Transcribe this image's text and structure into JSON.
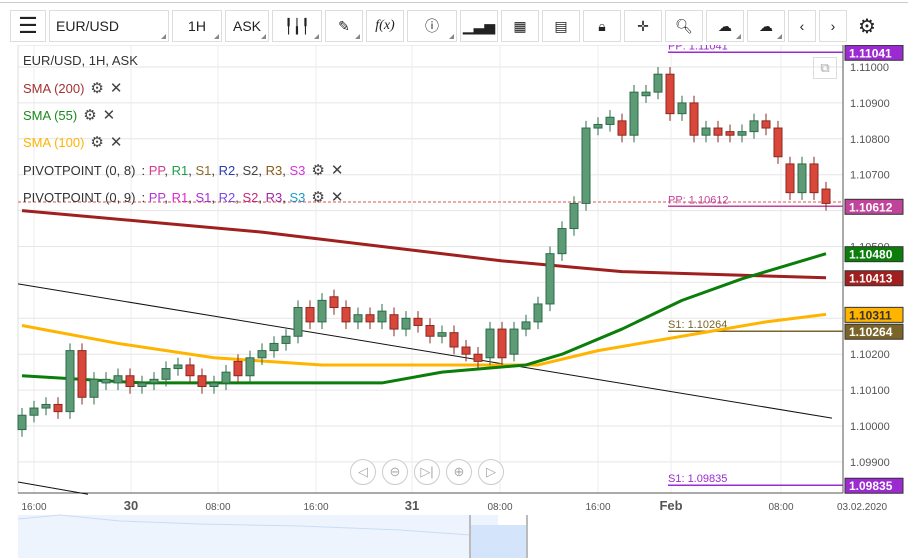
{
  "toolbar": {
    "menu_icon": "menu-icon",
    "symbol": "EUR/USD",
    "interval": "1H",
    "price_type": "ASK",
    "buttons": [
      "candles-icon",
      "draw-icon",
      "function-icon",
      "info-icon",
      "bars-icon",
      "calendar-icon",
      "report-icon",
      "lock-icon",
      "crosshair-icon",
      "zoom-icon",
      "upload-icon",
      "download-icon",
      "prev-icon",
      "next-icon",
      "gear-icon"
    ],
    "fx_label": "f(x)"
  },
  "legend": {
    "title": "EUR/USD, 1H, ASK",
    "sma200": "SMA (200)",
    "sma55": "SMA (55)",
    "sma100": "SMA (100)",
    "pivot1": "PIVOTPOINT (0, 8)",
    "pivot2": "PIVOTPOINT (0, 9)",
    "sep": " : ",
    "pivot1_items": [
      {
        "t": "PP",
        "c": "#d63a8e"
      },
      {
        "t": "R1",
        "c": "#1aa04a"
      },
      {
        "t": "S1",
        "c": "#8a6a2a"
      },
      {
        "t": "R2",
        "c": "#2a3eb0"
      },
      {
        "t": "S2",
        "c": "#444444"
      },
      {
        "t": "R3",
        "c": "#8a5a1a"
      },
      {
        "t": "S3",
        "c": "#d632d6"
      }
    ],
    "pivot2_items": [
      {
        "t": "PP",
        "c": "#b238d6"
      },
      {
        "t": "R1",
        "c": "#e02ad0"
      },
      {
        "t": "S1",
        "c": "#a030d0"
      },
      {
        "t": "R2",
        "c": "#7a4ae0"
      },
      {
        "t": "S2",
        "c": "#c02a7a"
      },
      {
        "t": "R3",
        "c": "#a028a8"
      },
      {
        "t": "S3",
        "c": "#1a9ac8"
      }
    ]
  },
  "colors": {
    "up": "#5d9a76",
    "down": "#d9473a",
    "sma200": "#a01f1f",
    "sma55": "#0a7d0a",
    "sma100": "#ffb400"
  },
  "chart_data": {
    "type": "candlestick",
    "ylim": [
      1.0978,
      1.111
    ],
    "y_ticks": [
      "1.11000",
      "1.10900",
      "1.10800",
      "1.10700",
      "1.10500",
      "1.10200",
      "1.10100",
      "1.10000",
      "1.09900"
    ],
    "x_labels": [
      "16:00",
      "30",
      "08:00",
      "16:00",
      "31",
      "08:00",
      "16:00",
      "Feb",
      "08:00",
      "03.02.2020"
    ],
    "candles": [
      [
        1.0999,
        1.1003
      ],
      [
        1.1003,
        1.1005
      ],
      [
        1.1005,
        1.1006
      ],
      [
        1.1006,
        1.1004
      ],
      [
        1.1004,
        1.1021
      ],
      [
        1.1021,
        1.1008
      ],
      [
        1.1008,
        1.1013
      ],
      [
        1.1012,
        1.1013
      ],
      [
        1.1012,
        1.1014
      ],
      [
        1.1014,
        1.1011
      ],
      [
        1.1011,
        1.1012
      ],
      [
        1.1012,
        1.1013
      ],
      [
        1.1013,
        1.1016
      ],
      [
        1.1016,
        1.1017
      ],
      [
        1.1017,
        1.1014
      ],
      [
        1.1014,
        1.1011
      ],
      [
        1.1011,
        1.1012
      ],
      [
        1.1012,
        1.1015
      ],
      [
        1.1018,
        1.1014
      ],
      [
        1.1014,
        1.1019
      ],
      [
        1.1019,
        1.1021
      ],
      [
        1.1021,
        1.1023
      ],
      [
        1.1023,
        1.1025
      ],
      [
        1.1025,
        1.1033
      ],
      [
        1.1033,
        1.1029
      ],
      [
        1.1029,
        1.1035
      ],
      [
        1.1036,
        1.1033
      ],
      [
        1.1033,
        1.1029
      ],
      [
        1.1029,
        1.1031
      ],
      [
        1.1031,
        1.1029
      ],
      [
        1.1029,
        1.1032
      ],
      [
        1.1031,
        1.1027
      ],
      [
        1.1027,
        1.103
      ],
      [
        1.103,
        1.1028
      ],
      [
        1.1028,
        1.1025
      ],
      [
        1.1025,
        1.1026
      ],
      [
        1.1026,
        1.1022
      ],
      [
        1.1022,
        1.102
      ],
      [
        1.102,
        1.1018
      ],
      [
        1.1019,
        1.1027
      ],
      [
        1.1027,
        1.1019
      ],
      [
        1.102,
        1.1027
      ],
      [
        1.1027,
        1.1029
      ],
      [
        1.1029,
        1.1034
      ],
      [
        1.1034,
        1.1048
      ],
      [
        1.1048,
        1.1055
      ],
      [
        1.1055,
        1.1062
      ],
      [
        1.1062,
        1.1083
      ],
      [
        1.1083,
        1.1084
      ],
      [
        1.1084,
        1.1086
      ],
      [
        1.1085,
        1.1081
      ],
      [
        1.1081,
        1.1093
      ],
      [
        1.1092,
        1.1093
      ],
      [
        1.1093,
        1.1098
      ],
      [
        1.1098,
        1.1087
      ],
      [
        1.1087,
        1.109
      ],
      [
        1.109,
        1.1081
      ],
      [
        1.1081,
        1.1083
      ],
      [
        1.1083,
        1.1081
      ],
      [
        1.1082,
        1.1081
      ],
      [
        1.1081,
        1.1082
      ],
      [
        1.1082,
        1.1085
      ],
      [
        1.1085,
        1.1083
      ],
      [
        1.1083,
        1.1075
      ],
      [
        1.1073,
        1.1065
      ],
      [
        1.1065,
        1.1073
      ],
      [
        1.1073,
        1.1065
      ],
      [
        1.1066,
        1.1062
      ]
    ],
    "sma200": [
      [
        0,
        1.106
      ],
      [
        10,
        1.1057
      ],
      [
        20,
        1.1054
      ],
      [
        30,
        1.105
      ],
      [
        40,
        1.1046
      ],
      [
        50,
        1.1043
      ],
      [
        60,
        1.1042
      ],
      [
        67,
        1.10413
      ]
    ],
    "sma55": [
      [
        0,
        1.1014
      ],
      [
        10,
        1.1012
      ],
      [
        20,
        1.1012
      ],
      [
        30,
        1.1012
      ],
      [
        35,
        1.1015
      ],
      [
        42,
        1.1017
      ],
      [
        45,
        1.102
      ],
      [
        50,
        1.1027
      ],
      [
        55,
        1.1035
      ],
      [
        60,
        1.1041
      ],
      [
        67,
        1.1048
      ]
    ],
    "sma100": [
      [
        0,
        1.1028
      ],
      [
        8,
        1.1023
      ],
      [
        16,
        1.1019
      ],
      [
        25,
        1.1017
      ],
      [
        35,
        1.1017
      ],
      [
        43,
        1.1017
      ],
      [
        48,
        1.1021
      ],
      [
        55,
        1.1025
      ],
      [
        62,
        1.1029
      ],
      [
        67,
        1.10311
      ]
    ],
    "trendlines": [
      [
        [
          0,
          1.10396
        ],
        [
          68,
          1.10022
        ]
      ],
      [
        [
          0,
          1.09844
        ],
        [
          6,
          1.0981
        ]
      ]
    ],
    "levels": [
      {
        "label": "PP: 1.11041",
        "value": 1.11041,
        "tag": "1.11041",
        "color": "#9b2bd0"
      },
      {
        "label": "PP: 1.10612",
        "value": 1.10612,
        "tag": "1.10612",
        "color": "#c0449a"
      },
      {
        "label": "S1: 1.10264",
        "value": 1.10264,
        "tag": "1.10264",
        "color": "#7a6428"
      },
      {
        "label": "S1: 1.09835",
        "value": 1.09835,
        "tag": "1.09835",
        "color": "#9b2bd0"
      }
    ],
    "tags": [
      {
        "value": 1.1048,
        "text": "1.10480",
        "color": "#0a7d0a"
      },
      {
        "value": 1.10413,
        "text": "1.10413",
        "color": "#a01f1f"
      },
      {
        "value": 1.10311,
        "text": "1.10311",
        "color": "#ffb400"
      }
    ],
    "current_price": 1.10624
  }
}
